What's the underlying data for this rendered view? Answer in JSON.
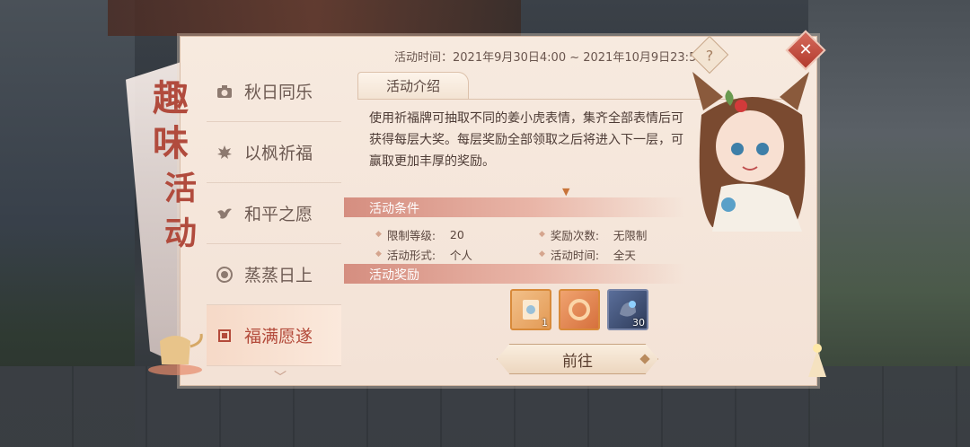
{
  "side_title": [
    "趣",
    "味",
    "活",
    "动"
  ],
  "tabs": [
    {
      "label": "秋日同乐",
      "icon": "camera-icon",
      "active": false
    },
    {
      "label": "以枫祈福",
      "icon": "maple-leaf-icon",
      "active": false
    },
    {
      "label": "和平之愿",
      "icon": "dove-icon",
      "active": false
    },
    {
      "label": "蒸蒸日上",
      "icon": "steamer-icon",
      "active": false
    },
    {
      "label": "福满愿遂",
      "icon": "charm-icon",
      "active": true
    }
  ],
  "activity_time": "活动时间：2021年9月30日4:00 ~ 2021年10月9日23:59",
  "help_label": "?",
  "close_label": "✕",
  "intro": {
    "tab_label": "活动介绍",
    "text": "使用祈福牌可抽取不同的姜小虎表情，集齐全部表情后可获得每层大奖。每层奖励全部领取之后将进入下一层，可赢取更加丰厚的奖励。"
  },
  "conditions": {
    "title": "活动条件",
    "items": [
      {
        "key": "限制等级:",
        "value": "20"
      },
      {
        "key": "奖励次数:",
        "value": "无限制"
      },
      {
        "key": "活动形式:",
        "value": "个人"
      },
      {
        "key": "活动时间:",
        "value": "全天"
      }
    ]
  },
  "rewards": {
    "title": "活动奖励",
    "items": [
      {
        "name": "reward-item-1",
        "count": "1"
      },
      {
        "name": "reward-item-2",
        "count": ""
      },
      {
        "name": "reward-item-3",
        "count": "30"
      }
    ]
  },
  "go_button": "前往",
  "colors": {
    "accent": "#b34a3a",
    "panel": "#f3e2d6",
    "band": "#d58e80"
  }
}
